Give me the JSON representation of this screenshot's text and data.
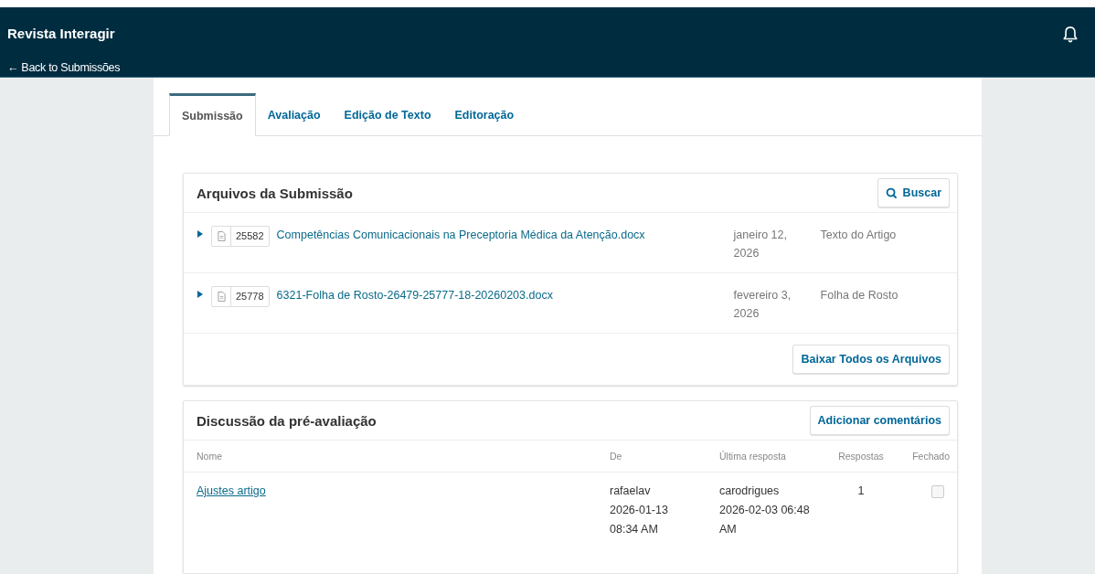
{
  "header": {
    "title": "Revista Interagir",
    "back_link": "← Back to Submissões"
  },
  "tabs": [
    {
      "label": "Submissão",
      "selected": true
    },
    {
      "label": "Avaliação",
      "selected": false
    },
    {
      "label": "Edição de Texto",
      "selected": false
    },
    {
      "label": "Editoração",
      "selected": false
    }
  ],
  "files_panel": {
    "title": "Arquivos da Submissão",
    "search_button": "Buscar",
    "files": [
      {
        "id": "25582",
        "name": "Competências Comunicacionais na Preceptoria Médica da Atenção.docx",
        "date": "janeiro 12, 2026",
        "type": "Texto do Artigo",
        "expanded": false
      },
      {
        "id": "25778",
        "name": "6321-Folha de Rosto-26479-25777-18-20260203.docx",
        "date": "fevereiro 3, 2026",
        "type": "Folha de Rosto",
        "expanded": false
      }
    ],
    "download_button": "Baixar Todos os Arquivos"
  },
  "discussion_panel": {
    "title": "Discussão da pré-avaliação",
    "add_button": "Adicionar comentários",
    "columns": [
      "Nome",
      "De",
      "Última resposta",
      "Respostas",
      "Fechado"
    ],
    "rows": [
      {
        "name": "Ajustes artigo",
        "from_user": "rafaelav",
        "from_date": "2026-01-13 08:34 AM",
        "last_user": "carodrigues",
        "last_date": "2026-02-03 06:48 AM",
        "replies": "1",
        "closed": false
      }
    ]
  }
}
